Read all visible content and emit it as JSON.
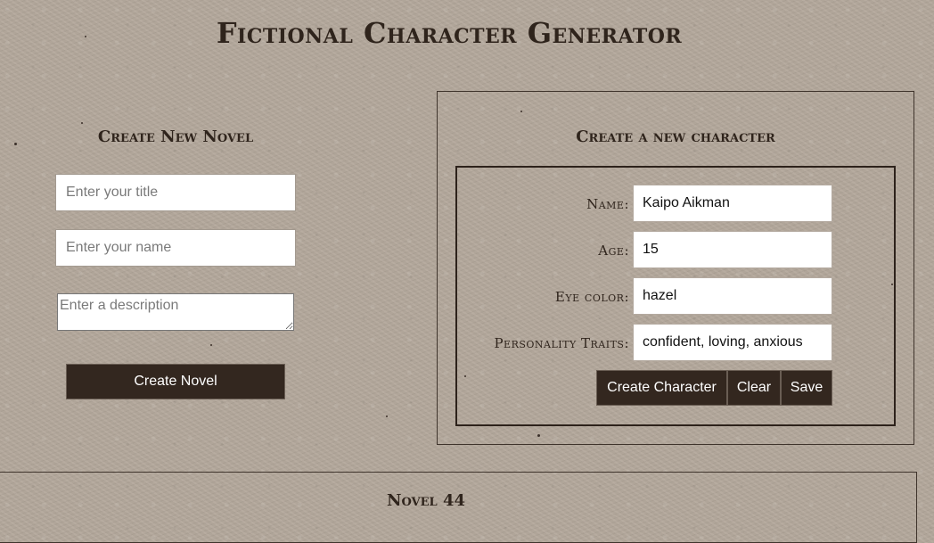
{
  "page": {
    "title": "Fictional Character Generator"
  },
  "novel_form": {
    "heading": "Create New Novel",
    "title_placeholder": "Enter your title",
    "title_value": "",
    "name_placeholder": "Enter your name",
    "name_value": "",
    "description_placeholder": "Enter a description",
    "description_value": "",
    "submit_label": "Create Novel"
  },
  "character_form": {
    "heading": "Create a new character",
    "fields": {
      "name": {
        "label": "Name:",
        "value": "Kaipo Aikman"
      },
      "age": {
        "label": "Age:",
        "value": "15"
      },
      "eye_color": {
        "label": "Eye color:",
        "value": "hazel"
      },
      "personality_traits": {
        "label": "Personality Traits:",
        "value": "confident, loving, anxious"
      }
    },
    "buttons": {
      "create_label": "Create Character",
      "clear_label": "Clear",
      "save_label": "Save"
    }
  },
  "novels": [
    {
      "heading": "Novel 44"
    }
  ],
  "colors": {
    "background": "#b3a79b",
    "button": "#33271f",
    "text": "#2f241c"
  }
}
